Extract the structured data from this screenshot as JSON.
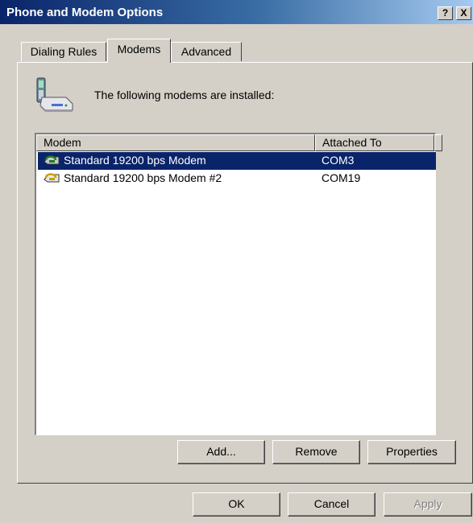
{
  "window": {
    "title": "Phone and Modem Options",
    "help_button": "?",
    "close_button": "X"
  },
  "tabs": [
    {
      "label": "Dialing Rules",
      "selected": false
    },
    {
      "label": "Modems",
      "selected": true
    },
    {
      "label": "Advanced",
      "selected": false
    }
  ],
  "modems_page": {
    "intro_text": "The following modems are installed:",
    "columns": [
      "Modem",
      "Attached To"
    ],
    "rows": [
      {
        "name": "Standard 19200 bps Modem",
        "port": "COM3",
        "selected": true,
        "icon": "modem-icon"
      },
      {
        "name": "Standard 19200 bps Modem #2",
        "port": "COM19",
        "selected": false,
        "icon": "modem-icon"
      }
    ],
    "buttons": {
      "add": "Add...",
      "remove": "Remove",
      "properties": "Properties"
    }
  },
  "footer": {
    "ok": "OK",
    "cancel": "Cancel",
    "apply": "Apply",
    "apply_enabled": false
  },
  "colors": {
    "titlebar": "#0a246a",
    "selection": "#0a246a",
    "face": "#d4d0c8"
  }
}
